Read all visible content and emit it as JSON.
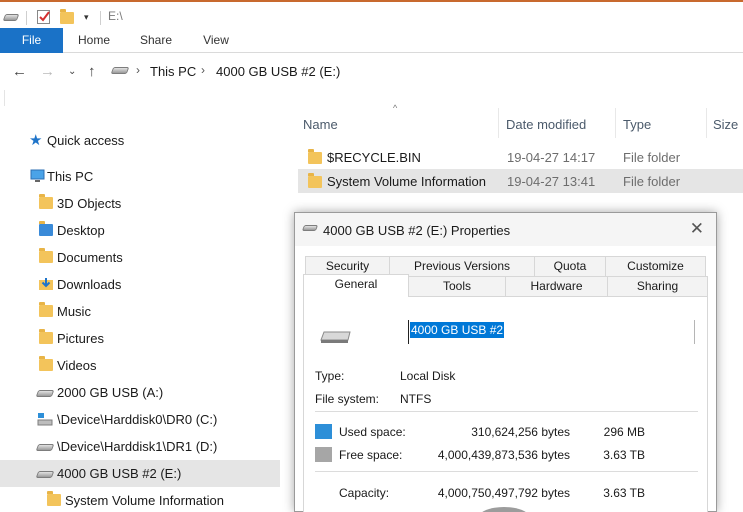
{
  "window": {
    "title": "E:\\"
  },
  "ribbon": {
    "tabs": [
      "File",
      "Home",
      "Share",
      "View"
    ]
  },
  "address": {
    "crumbs": [
      "This PC",
      "4000 GB USB #2 (E:)"
    ]
  },
  "nav_pane": {
    "items": [
      {
        "label": "Quick access",
        "icon": "star-icon"
      },
      {
        "label": "This PC",
        "icon": "computer-icon"
      },
      {
        "label": "3D Objects",
        "icon": "folder-icon"
      },
      {
        "label": "Desktop",
        "icon": "desktop-folder-icon"
      },
      {
        "label": "Documents",
        "icon": "documents-folder-icon"
      },
      {
        "label": "Downloads",
        "icon": "downloads-folder-icon"
      },
      {
        "label": "Music",
        "icon": "music-folder-icon"
      },
      {
        "label": "Pictures",
        "icon": "pictures-folder-icon"
      },
      {
        "label": "Videos",
        "icon": "videos-folder-icon"
      },
      {
        "label": "2000 GB USB (A:)",
        "icon": "usb-drive-icon"
      },
      {
        "label": "\\Device\\Harddisk0\\DR0 (C:)",
        "icon": "system-drive-icon"
      },
      {
        "label": "\\Device\\Harddisk1\\DR1 (D:)",
        "icon": "drive-icon"
      },
      {
        "label": "4000 GB USB #2 (E:)",
        "icon": "usb-drive-icon"
      },
      {
        "label": "System Volume Information",
        "icon": "folder-icon"
      }
    ]
  },
  "file_list": {
    "columns": [
      "Name",
      "Date modified",
      "Type",
      "Size"
    ],
    "rows": [
      {
        "name": "$RECYCLE.BIN",
        "date": "19-04-27 14:17",
        "type": "File folder"
      },
      {
        "name": "System Volume Information",
        "date": "19-04-27 13:41",
        "type": "File folder"
      }
    ]
  },
  "dialog": {
    "title": "4000 GB USB #2 (E:) Properties",
    "tabs_back": [
      "Security",
      "Previous Versions",
      "Quota",
      "Customize"
    ],
    "tabs_front": [
      "General",
      "Tools",
      "Hardware",
      "Sharing"
    ],
    "drive_name": "4000 GB USB #2",
    "type_label": "Type:",
    "type_value": "Local Disk",
    "fs_label": "File system:",
    "fs_value": "NTFS",
    "used_label": "Used space:",
    "used_bytes": "310,624,256 bytes",
    "used_size": "296 MB",
    "free_label": "Free space:",
    "free_bytes": "4,000,439,873,536 bytes",
    "free_size": "3.63 TB",
    "cap_label": "Capacity:",
    "cap_bytes": "4,000,750,497,792 bytes",
    "cap_size": "3.63 TB",
    "colors": {
      "used": "#2d8fd8",
      "free": "#a6a6a6"
    }
  }
}
